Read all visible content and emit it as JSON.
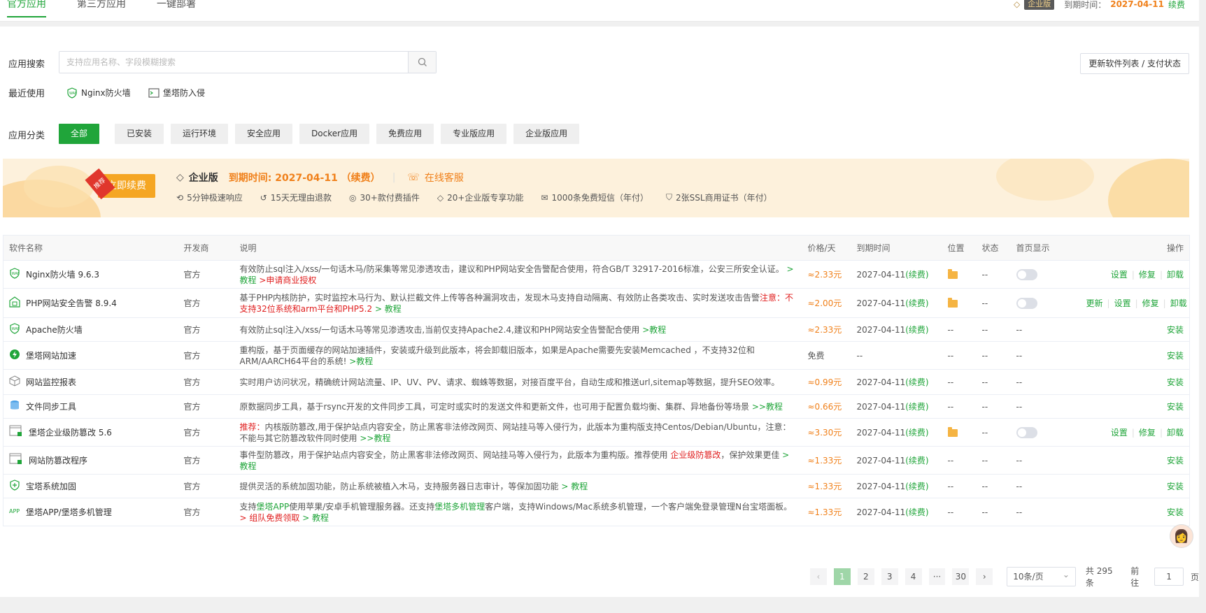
{
  "tabs": [
    "官方应用",
    "第三方应用",
    "一键部署"
  ],
  "top_right": {
    "edition": "企业版",
    "expire_label": "到期时间：",
    "expire_date": "2027-04-11",
    "renew": "续费"
  },
  "search": {
    "label": "应用搜索",
    "placeholder": "支持应用名称、字段模糊搜索"
  },
  "update_button": "更新软件列表 / 支付状态",
  "recent": {
    "label": "最近使用",
    "items": [
      "Nginx防火墙",
      "堡塔防入侵"
    ]
  },
  "categories": {
    "label": "应用分类",
    "items": [
      "全部",
      "已安装",
      "运行环境",
      "安全应用",
      "Docker应用",
      "免费应用",
      "专业版应用",
      "企业版应用"
    ]
  },
  "banner": {
    "tag": "推荐",
    "renew_button": "立即续费",
    "edition": "企业版",
    "expire": "到期时间: 2027-04-11 （续费）",
    "service": "在线客服",
    "features": [
      "5分钟极速响应",
      "15天无理由退款",
      "30+款付费插件",
      "20+企业版专享功能",
      "1000条免费短信（年付）",
      "2张SSL商用证书（年付）"
    ]
  },
  "table": {
    "headers": [
      "软件名称",
      "开发商",
      "说明",
      "价格/天",
      "到期时间",
      "位置",
      "状态",
      "首页显示",
      "操作"
    ],
    "rows": [
      {
        "name": "Nginx防火墙 9.6.3",
        "icon": "waf-icon",
        "vendor": "官方",
        "desc": "有效防止sql注入/xss/一句话木马/防采集等常见渗透攻击，建议和PHP网站安全告警配合使用，符合GB/T 32917-2016标准，公安三所安全认证。",
        "extra1": " > 教程 ",
        "extra2": ">申请商业授权",
        "price": "≈2.33元",
        "expire": "2027-04-11",
        "renew": "(续费)",
        "pos": "folder",
        "status": "--",
        "toggle": true,
        "ops": [
          "设置",
          "修复",
          "卸载"
        ]
      },
      {
        "name": "PHP网站安全告警 8.9.4",
        "icon": "php-alert-icon",
        "vendor": "官方",
        "desc": "基于PHP内核防护，实时监控木马行为、默认拦截文件上传等各种漏洞攻击，发现木马支持自动隔离、有效防止各类攻击、实时发送攻击告警",
        "extra1": "注意：不支持32位系统和arm平台和PHP5.2",
        "extra2": " > 教程",
        "price": "≈2.00元",
        "expire": "2027-04-11",
        "renew": "(续费)",
        "pos": "folder",
        "status": "--",
        "toggle": true,
        "ops": [
          "更新",
          "设置",
          "修复",
          "卸载"
        ]
      },
      {
        "name": "Apache防火墙",
        "icon": "waf-icon",
        "vendor": "官方",
        "desc": "有效防止sql注入/xss/一句话木马等常见渗透攻击,当前仅支持Apache2.4,建议和PHP网站安全告警配合使用",
        "extra1": " >教程",
        "extra2": "",
        "price": "≈2.33元",
        "expire": "2027-04-11",
        "renew": "(续费)",
        "pos": "--",
        "status": "--",
        "toggle": false,
        "show": "--",
        "ops": [
          "安装"
        ]
      },
      {
        "name": "堡塔网站加速",
        "icon": "lightning-icon",
        "vendor": "官方",
        "desc": "重构版，基于页面缓存的网站加速插件，安装或升级到此版本，将会卸载旧版本，如果是Apache需要先安装Memcached ，不支持32位和ARM/AARCH64平台的系统!",
        "extra1": " >教程",
        "extra2": "",
        "price": "免费",
        "free": true,
        "expire": "--",
        "renew": "",
        "pos": "--",
        "status": "--",
        "toggle": false,
        "show": "--",
        "ops": [
          "安装"
        ]
      },
      {
        "name": "网站监控报表",
        "icon": "cube-icon",
        "vendor": "官方",
        "desc": "实时用户访问状况，精确统计网站流量、IP、UV、PV、请求、蜘蛛等数据，对接百度平台，自动生成和推送url,sitemap等数据，提升SEO效率。",
        "extra1": "",
        "extra2": "",
        "price": "≈0.99元",
        "expire": "2027-04-11",
        "renew": "(续费)",
        "pos": "--",
        "status": "--",
        "toggle": false,
        "show": "--",
        "ops": [
          "安装"
        ]
      },
      {
        "name": "文件同步工具",
        "icon": "database-icon",
        "vendor": "官方",
        "desc": "原数据同步工具，基于rsync开发的文件同步工具，可定时或实时的发送文件和更新文件，也可用于配置负载均衡、集群、异地备份等场景",
        "extra1": " >>教程",
        "extra2": "",
        "price": "≈0.66元",
        "expire": "2027-04-11",
        "renew": "(续费)",
        "pos": "--",
        "status": "--",
        "toggle": false,
        "show": "--",
        "ops": [
          "安装"
        ]
      },
      {
        "name": "堡塔企业级防篡改 5.6",
        "icon": "window-lock-icon",
        "vendor": "官方",
        "prefix": "推荐：",
        "desc": "内核版防篡改,用于保护站点内容安全，防止黑客非法修改网页、网站挂马等入侵行为，此版本为重构版支持Centos/Debian/Ubuntu，注意：不能与其它防篡改软件同时使用",
        "extra1": " >>教程",
        "extra2": "",
        "price": "≈3.30元",
        "expire": "2027-04-11",
        "renew": "(续费)",
        "pos": "folder",
        "status": "--",
        "toggle": true,
        "ops": [
          "设置",
          "修复",
          "卸载"
        ]
      },
      {
        "name": "网站防篡改程序",
        "icon": "window-lock-icon",
        "vendor": "官方",
        "desc": "事件型防篡改，用于保护站点内容安全，防止黑客非法修改网页、网站挂马等入侵行为，此版本为重构版。推荐使用 ",
        "mid": "企业级防篡改",
        "desc2": "，保护效果更佳",
        "extra1": " > 教程",
        "extra2": "",
        "price": "≈1.33元",
        "expire": "2027-04-11",
        "renew": "(续费)",
        "pos": "--",
        "status": "--",
        "toggle": false,
        "show": "--",
        "ops": [
          "安装"
        ]
      },
      {
        "name": "宝塔系统加固",
        "icon": "shield-plus-icon",
        "vendor": "官方",
        "desc": "提供灵活的系统加固功能，防止系统被植入木马，支持服务器日志审计，等保加固功能",
        "extra1": " > 教程",
        "extra2": "",
        "price": "≈1.33元",
        "expire": "2027-04-11",
        "renew": "(续费)",
        "pos": "--",
        "status": "--",
        "toggle": false,
        "show": "--",
        "ops": [
          "安装"
        ]
      },
      {
        "name": "堡塔APP/堡塔多机管理",
        "icon": "app-icon",
        "vendor": "官方",
        "desc": "支持",
        "g1": "堡塔APP",
        "desc2": "使用苹果/安卓手机管理服务器。还支持",
        "g2": "堡塔多机管理",
        "desc3": "客户端，支持Windows/Mac系统多机管理，一个客户端免登录管理N台宝塔面板。",
        "extra2": "> 组队免费领取",
        "extra1": " > 教程",
        "price": "≈1.33元",
        "expire": "2027-04-11",
        "renew": "(续费)",
        "pos": "--",
        "status": "--",
        "toggle": false,
        "show": "--",
        "ops": [
          "安装"
        ]
      }
    ]
  },
  "pagination": {
    "pages": [
      "1",
      "2",
      "3",
      "4",
      "···",
      "30"
    ],
    "active": "1",
    "page_size": "10条/页",
    "total": "共 295 条",
    "goto_label": "前往",
    "goto_value": "1",
    "page_unit": "页"
  }
}
